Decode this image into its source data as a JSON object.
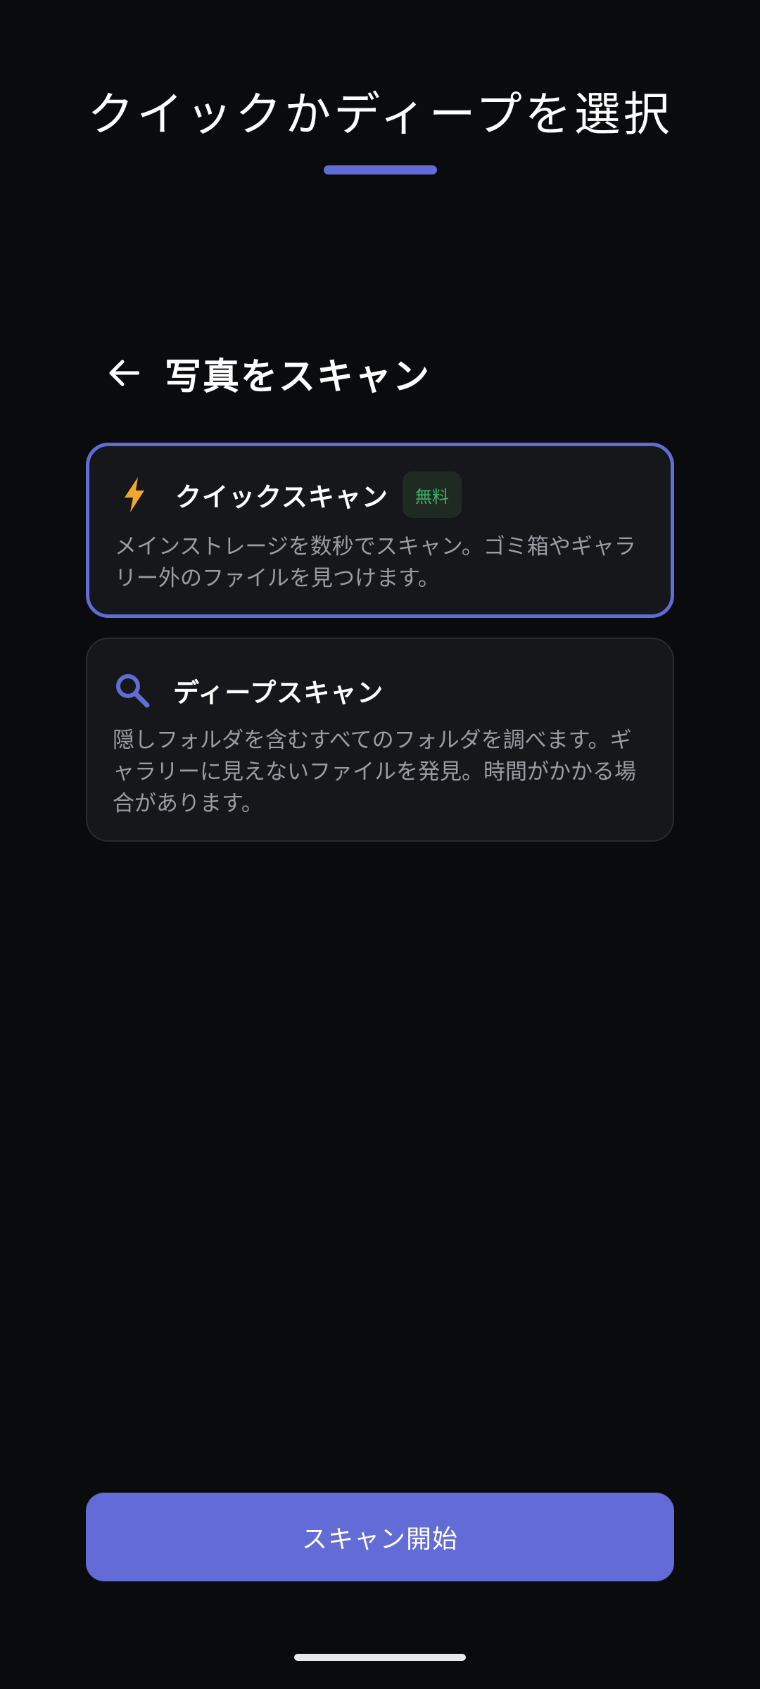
{
  "header": {
    "title": "クイックかディープを選択"
  },
  "section": {
    "title": "写真をスキャン"
  },
  "options": [
    {
      "id": "quick",
      "title": "クイックスキャン",
      "badge": "無料",
      "description": "メインストレージを数秒でスキャン。ゴミ箱やギャラリー外のファイルを見つけます。",
      "icon": "lightning-icon",
      "selected": true
    },
    {
      "id": "deep",
      "title": "ディープスキャン",
      "description": "隠しフォルダを含むすべてのフォルダを調べます。ギャラリーに見えないファイルを発見。時間がかかる場合があります。",
      "icon": "search-icon",
      "selected": false
    }
  ],
  "actions": {
    "start_label": "スキャン開始"
  },
  "colors": {
    "accent": "#636bd6",
    "background": "#0a0b0d",
    "card": "#16171b",
    "lightning": "#f0a92a",
    "badge_text": "#3fb36a"
  }
}
